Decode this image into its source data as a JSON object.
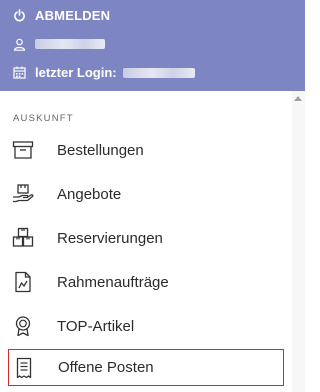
{
  "header": {
    "logout_label": "ABMELDEN",
    "last_login_label": "letzter Login:"
  },
  "menu": {
    "section_label": "AUSKUNFT",
    "items": [
      {
        "label": "Bestellungen",
        "icon": "archive-box-icon"
      },
      {
        "label": "Angebote",
        "icon": "hand-box-icon"
      },
      {
        "label": "Reservierungen",
        "icon": "stacked-boxes-icon"
      },
      {
        "label": "Rahmenaufträge",
        "icon": "document-chart-icon"
      },
      {
        "label": "TOP-Artikel",
        "icon": "award-badge-icon"
      },
      {
        "label": "Offene Posten",
        "icon": "receipt-icon",
        "selected": true
      }
    ]
  },
  "colors": {
    "header_bg": "#7d86c2",
    "selection_border": "#d32b2b"
  }
}
